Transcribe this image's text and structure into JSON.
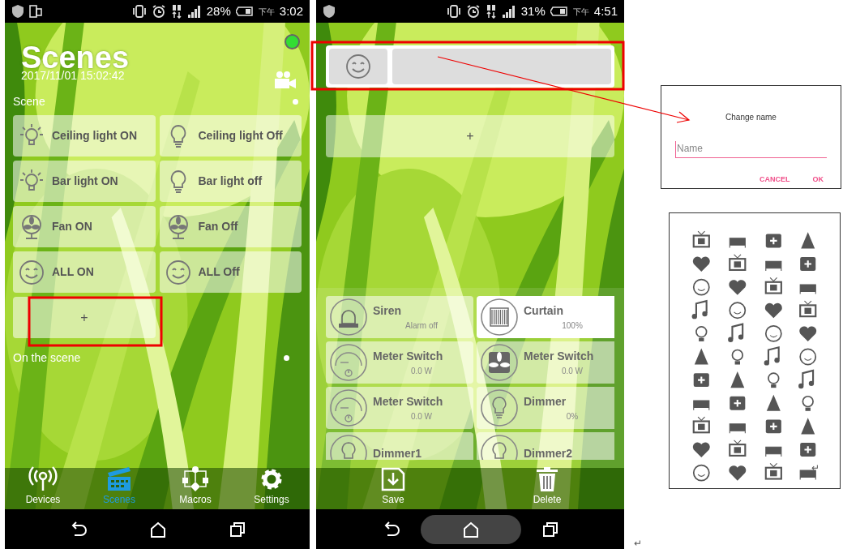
{
  "phones": [
    {
      "kind": "scenes",
      "status_bar": {
        "rotation_lock": true,
        "battery": "28%",
        "period": "下午",
        "time": "3:02"
      },
      "title": "Scenes",
      "datetime": "2017/11/01 15:02:42",
      "scene_section": {
        "label": "Scene",
        "add_label": "+",
        "tiles": [
          {
            "label": "Ceiling light ON",
            "kind": "glow"
          },
          {
            "label": "Ceiling light Off",
            "kind": "bulb"
          },
          {
            "label": "Bar light ON",
            "kind": "glow"
          },
          {
            "label": "Bar light off",
            "kind": "bulb"
          },
          {
            "label": "Fan ON",
            "kind": "fan"
          },
          {
            "label": "Fan Off",
            "kind": "fan"
          },
          {
            "label": "ALL ON",
            "kind": "smile"
          },
          {
            "label": "ALL Off",
            "kind": "smile"
          }
        ]
      },
      "active_section": {
        "label": "On the scene"
      },
      "tabs": [
        {
          "label": "Devices",
          "selected": false
        },
        {
          "label": "Scenes",
          "selected": true
        },
        {
          "label": "Macros",
          "selected": false
        },
        {
          "label": "Settings",
          "selected": false
        }
      ],
      "home_pressed": false
    },
    {
      "kind": "editor",
      "status_bar": {
        "battery": "31%",
        "period": "下午",
        "time": "4:51"
      },
      "add_label": "+",
      "devices": [
        {
          "name": "Siren",
          "status": "Alarm off",
          "kind": "siren",
          "on": false
        },
        {
          "name": "Curtain",
          "status": "100%",
          "kind": "curtain",
          "on": true
        },
        {
          "name": "Meter Switch",
          "status": "0.0 W",
          "kind": "meter",
          "on": false
        },
        {
          "name": "Meter Switch",
          "status": "0.0 W",
          "kind": "fan",
          "on": false
        },
        {
          "name": "Meter Switch",
          "status": "0.0 W",
          "kind": "meter",
          "on": false
        },
        {
          "name": "Dimmer",
          "status": "0%",
          "kind": "bulb",
          "on": false
        },
        {
          "name": "Dimmer1",
          "kind": "bulb",
          "on": false
        },
        {
          "name": "Dimmer2",
          "kind": "bulb",
          "on": false
        }
      ],
      "actions": [
        "Save",
        "Delete"
      ],
      "home_pressed": true
    }
  ],
  "dialog": {
    "title": "Change name",
    "placeholder": "Name",
    "buttons": [
      "CANCEL",
      "OK"
    ]
  },
  "marks": [
    "↵",
    "↵"
  ]
}
